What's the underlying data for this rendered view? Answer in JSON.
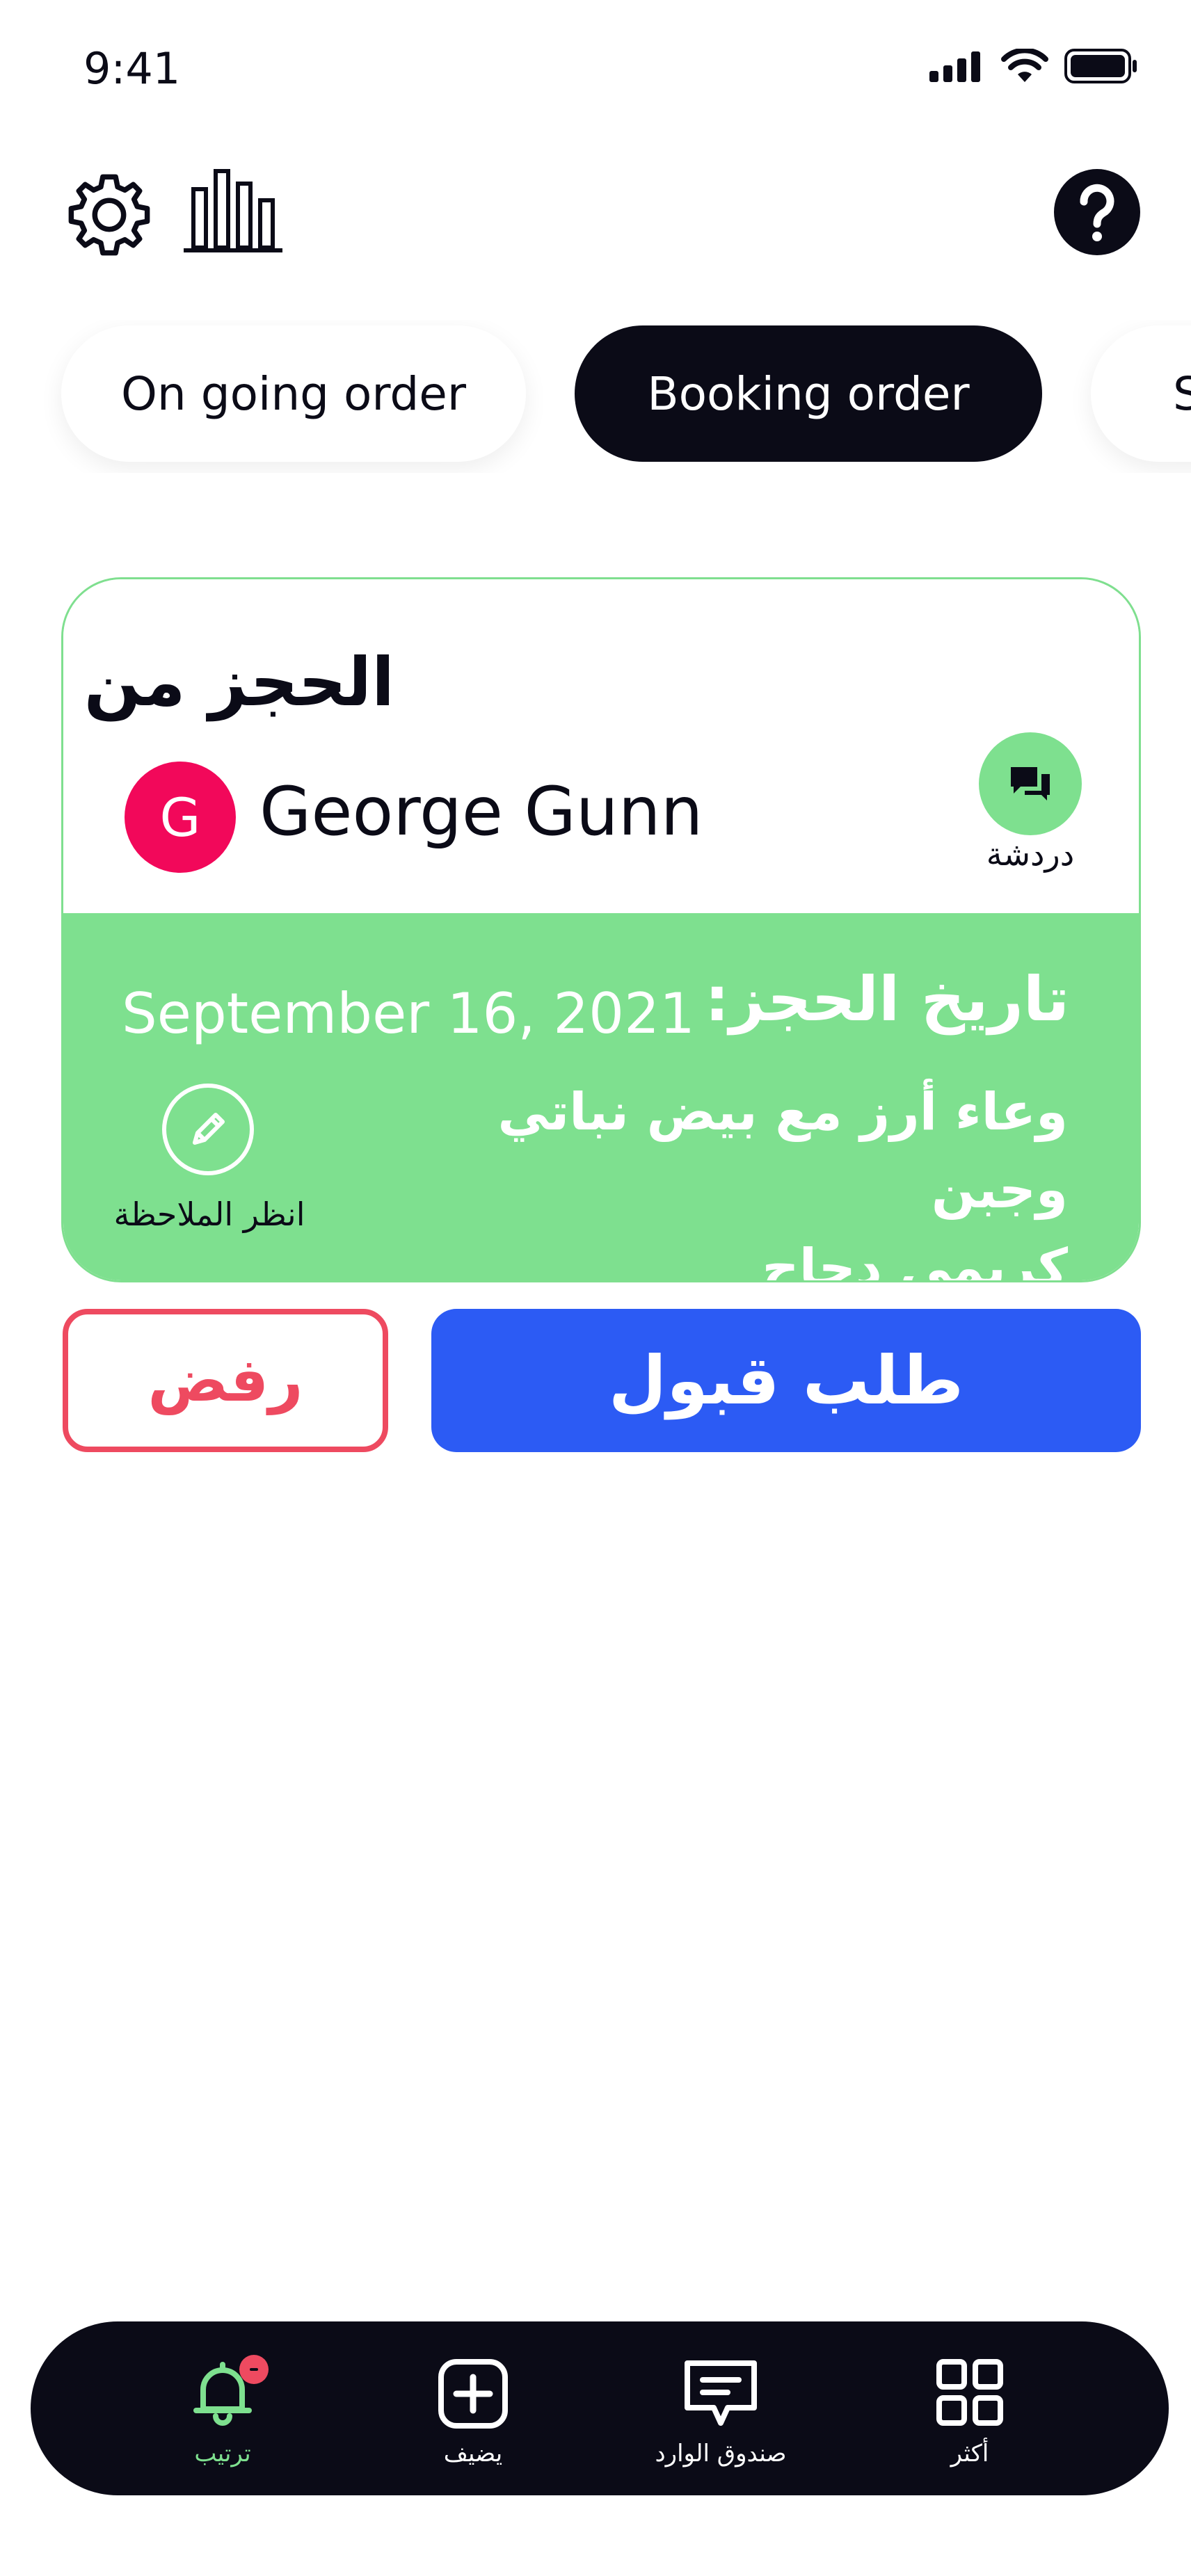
{
  "status_bar": {
    "time": "9:41",
    "icons": [
      "signal-icon",
      "wifi-icon",
      "battery-icon"
    ]
  },
  "toolbar": {
    "icons": [
      "gear-icon",
      "bar-chart-icon",
      "help-icon"
    ]
  },
  "tabs": [
    {
      "label": "On going order",
      "active": false
    },
    {
      "label": "Booking order",
      "active": true
    },
    {
      "label": "S",
      "active": false
    }
  ],
  "booking_card": {
    "title": "الحجز من",
    "customer_initial": "G",
    "customer_name": "George Gunn",
    "chat_label": "دردشة",
    "date_label": "تاريخ الحجز:",
    "date_value": "September 16, 2021",
    "order_items_line1": "وعاء أرز مع بيض نباتي وجبن",
    "order_items_line2": "كريمي دجاج",
    "note_label": "انظر الملاحظة"
  },
  "actions": {
    "reject_label": "رفض",
    "accept_label": "طلب قبول"
  },
  "bottom_nav": [
    {
      "label": "ترتيب",
      "icon": "bell-icon",
      "active": true,
      "has_badge": true
    },
    {
      "label": "يضيف",
      "icon": "add-square-icon",
      "active": false
    },
    {
      "label": "صندوق الوارد",
      "icon": "inbox-message-icon",
      "active": false
    },
    {
      "label": "أكثر",
      "icon": "grid-icon",
      "active": false
    }
  ],
  "colors": {
    "dark": "#0b0b17",
    "green": "#7ee08f",
    "blue": "#2c5bf4",
    "red": "#ee4a60",
    "avatar_pink": "#f2085a"
  }
}
